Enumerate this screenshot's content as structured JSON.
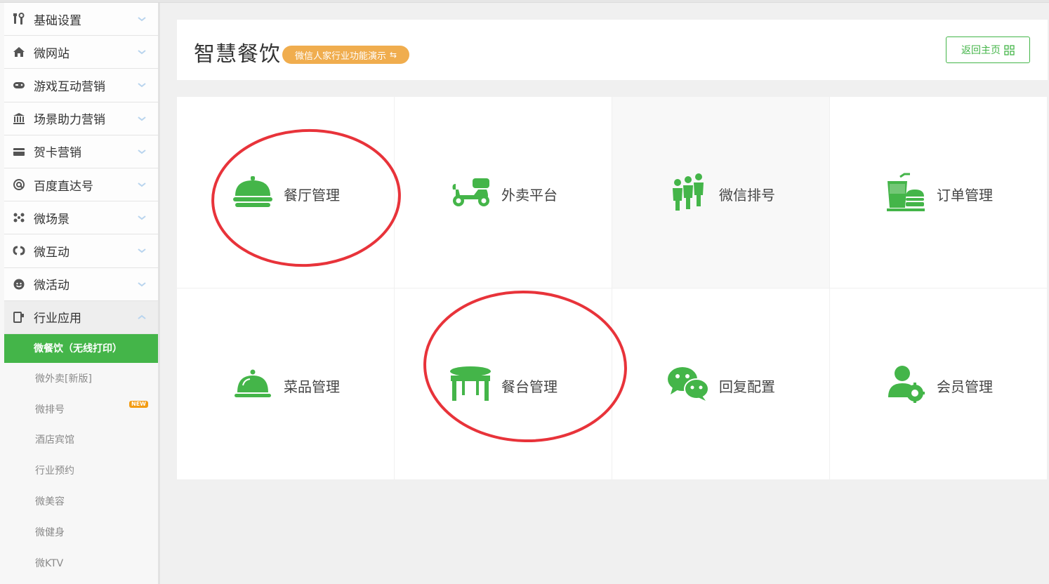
{
  "sidebar": {
    "items": [
      {
        "label": "基础设置",
        "icon": "tools-icon"
      },
      {
        "label": "微网站",
        "icon": "home-icon"
      },
      {
        "label": "游戏互动营销",
        "icon": "gamepad-icon"
      },
      {
        "label": "场景助力营销",
        "icon": "bank-icon"
      },
      {
        "label": "贺卡营销",
        "icon": "card-icon"
      },
      {
        "label": "百度直达号",
        "icon": "at-icon"
      },
      {
        "label": "微场景",
        "icon": "scene-icon"
      },
      {
        "label": "微互动",
        "icon": "interact-icon"
      },
      {
        "label": "微活动",
        "icon": "activity-icon"
      },
      {
        "label": "行业应用",
        "icon": "industry-icon"
      }
    ],
    "active_sub": "微餐饮（无线打印）",
    "sub_items": [
      "微外卖[新版]",
      "微排号",
      "酒店宾馆",
      "行业预约",
      "微美容",
      "微健身",
      "微KTV"
    ],
    "new_badge": "NEW"
  },
  "header": {
    "title": "智慧餐饮",
    "demo_badge": "微信人家行业功能演示",
    "demo_arrow": "⇆",
    "back_button": "返回主页"
  },
  "tiles": [
    {
      "label": "餐厅管理",
      "icon": "cloche-icon"
    },
    {
      "label": "外卖平台",
      "icon": "scooter-icon"
    },
    {
      "label": "微信排号",
      "icon": "queue-people-icon"
    },
    {
      "label": "订单管理",
      "icon": "fastfood-icon"
    },
    {
      "label": "菜品管理",
      "icon": "dish-icon"
    },
    {
      "label": "餐台管理",
      "icon": "table-icon"
    },
    {
      "label": "回复配置",
      "icon": "wechat-icon"
    },
    {
      "label": "会员管理",
      "icon": "member-settings-icon"
    }
  ],
  "colors": {
    "accent": "#44b549",
    "badge": "#f0ad4e",
    "annotation": "#e8333a"
  }
}
